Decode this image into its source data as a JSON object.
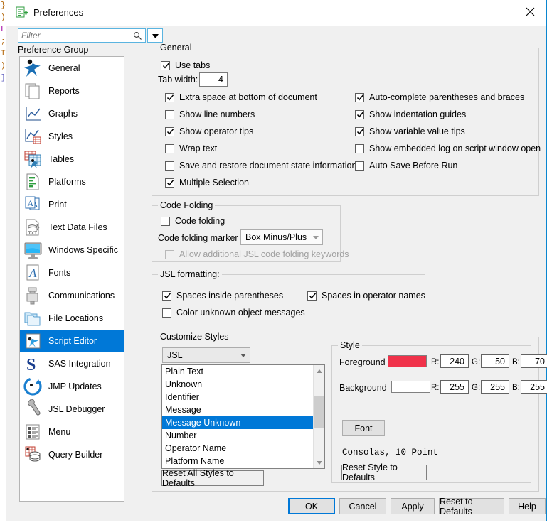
{
  "window": {
    "title": "Preferences",
    "close_label": "Close",
    "app_icon": "jmp-preferences-icon"
  },
  "filter": {
    "placeholder": "Filter",
    "value": "",
    "search_icon": "search-icon",
    "dropdown_icon": "chevron-down-icon"
  },
  "sidebar": {
    "label": "Preference Group",
    "selected": "Script Editor",
    "items": [
      {
        "label": "General",
        "icon": "general-icon"
      },
      {
        "label": "Reports",
        "icon": "reports-icon"
      },
      {
        "label": "Graphs",
        "icon": "graphs-icon"
      },
      {
        "label": "Styles",
        "icon": "styles-icon"
      },
      {
        "label": "Tables",
        "icon": "tables-icon"
      },
      {
        "label": "Platforms",
        "icon": "platforms-icon"
      },
      {
        "label": "Print",
        "icon": "print-icon"
      },
      {
        "label": "Text Data Files",
        "icon": "text-data-files-icon"
      },
      {
        "label": "Windows Specific",
        "icon": "windows-specific-icon"
      },
      {
        "label": "Fonts",
        "icon": "fonts-icon"
      },
      {
        "label": "Communications",
        "icon": "communications-icon"
      },
      {
        "label": "File Locations",
        "icon": "file-locations-icon"
      },
      {
        "label": "Script Editor",
        "icon": "script-editor-icon"
      },
      {
        "label": "SAS Integration",
        "icon": "sas-integration-icon"
      },
      {
        "label": "JMP Updates",
        "icon": "jmp-updates-icon"
      },
      {
        "label": "JSL Debugger",
        "icon": "jsl-debugger-icon"
      },
      {
        "label": "Menu",
        "icon": "menu-icon"
      },
      {
        "label": "Query Builder",
        "icon": "query-builder-icon"
      }
    ]
  },
  "general": {
    "title": "General",
    "use_tabs": {
      "label": "Use tabs",
      "checked": true
    },
    "tab_width": {
      "label": "Tab width:",
      "value": "4"
    },
    "left_column": [
      {
        "label": "Extra space at bottom of document",
        "checked": true
      },
      {
        "label": "Show line numbers",
        "checked": false
      },
      {
        "label": "Show operator tips",
        "checked": true
      },
      {
        "label": "Wrap text",
        "checked": false
      },
      {
        "label": "Save and restore document state information",
        "checked": false
      },
      {
        "label": "Multiple Selection",
        "checked": true
      }
    ],
    "right_column": [
      {
        "label": "Auto-complete parentheses and braces",
        "checked": true
      },
      {
        "label": "Show indentation guides",
        "checked": true
      },
      {
        "label": "Show variable value tips",
        "checked": true
      },
      {
        "label": "Show embedded log on script window open",
        "checked": false
      },
      {
        "label": "Auto Save Before Run",
        "checked": false
      }
    ]
  },
  "code_folding": {
    "title": "Code Folding",
    "code_folding": {
      "label": "Code folding",
      "checked": false
    },
    "marker_label": "Code folding marker",
    "marker_value": "Box Minus/Plus",
    "allow_keywords": {
      "label": "Allow additional JSL code folding keywords",
      "checked": false,
      "disabled": true
    }
  },
  "jsl_formatting": {
    "title": "JSL formatting:",
    "items": [
      {
        "label": "Spaces inside parentheses",
        "checked": true
      },
      {
        "label": "Spaces in operator names",
        "checked": true
      },
      {
        "label": "Color unknown object messages",
        "checked": false
      }
    ]
  },
  "customize_styles": {
    "title": "Customize Styles",
    "language": "JSL",
    "list_items": [
      "Plain Text",
      "Unknown",
      "Identifier",
      "Message",
      "Message Unknown",
      "Number",
      "Operator Name",
      "Platform Name"
    ],
    "selected_item": "Message Unknown",
    "reset_all_label": "Reset All Styles to Defaults"
  },
  "style_panel": {
    "title": "Style",
    "foreground_label": "Foreground",
    "foreground_color": "#f0324a",
    "foreground_rgb": {
      "r_label": "R:",
      "r": "240",
      "g_label": "G:",
      "g": "50",
      "b_label": "B:",
      "b": "70"
    },
    "background_label": "Background",
    "background_color": "#ffffff",
    "background_rgb": {
      "r_label": "R:",
      "r": "255",
      "g_label": "G:",
      "g": "255",
      "b_label": "B:",
      "b": "255"
    },
    "font_button": "Font",
    "font_description": "Consolas, 10 Point",
    "reset_style_label": "Reset Style to Defaults"
  },
  "footer": {
    "ok": "OK",
    "cancel": "Cancel",
    "apply": "Apply",
    "reset_to_defaults": "Reset to Defaults",
    "help": "Help"
  },
  "background_editor": {
    "lines": [
      "}",
      ")",
      "L",
      ";",
      "",
      "",
      "",
      "",
      "",
      "",
      "T",
      "",
      ")",
      "",
      "",
      "]",
      "",
      "",
      ""
    ]
  },
  "colors": {
    "accent": "#0078d7",
    "window_border": "#0a86d0",
    "dialog_bg": "#f0f0f0"
  }
}
